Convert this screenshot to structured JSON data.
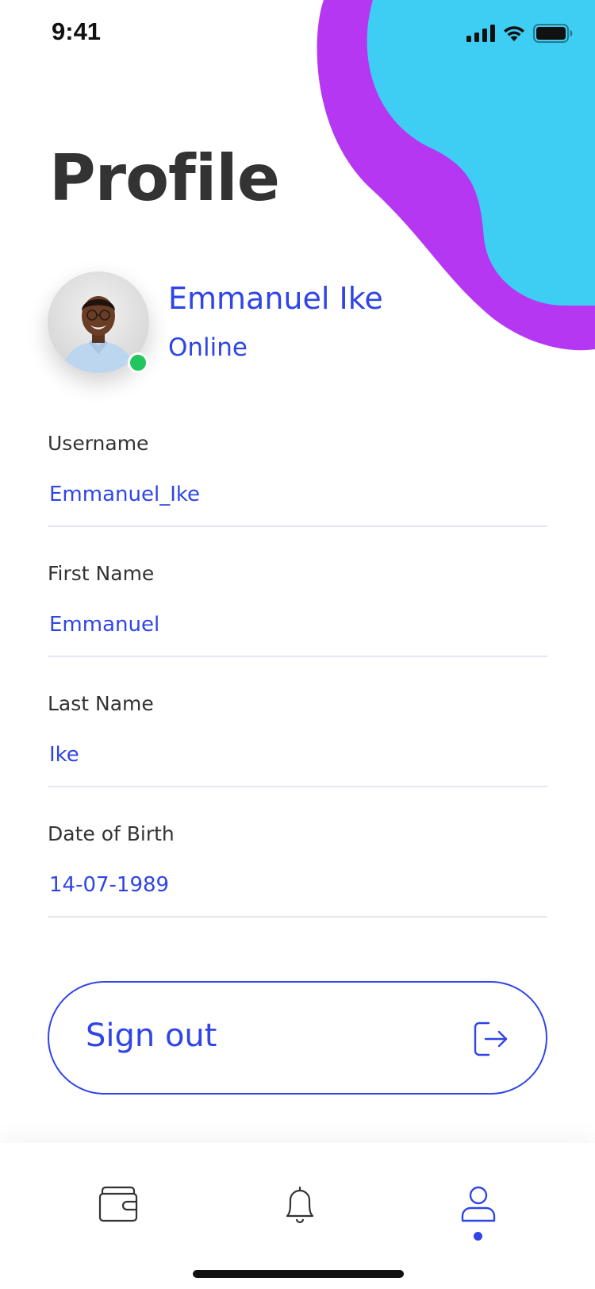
{
  "status_bar": {
    "time": "9:41"
  },
  "colors": {
    "accent": "#2f45e6",
    "blob_purple": "#b537f2",
    "blob_cyan": "#3ecef4",
    "online": "#22c55e",
    "title": "#333333"
  },
  "page": {
    "title": "Profile"
  },
  "profile": {
    "name": "Emmanuel Ike",
    "status": "Online"
  },
  "fields": [
    {
      "label": "Username",
      "value": "Emmanuel_Ike"
    },
    {
      "label": "First Name",
      "value": "Emmanuel"
    },
    {
      "label": "Last Name",
      "value": "Ike"
    },
    {
      "label": "Date of Birth",
      "value": "14-07-1989"
    }
  ],
  "signout": {
    "label": "Sign out",
    "icon": "logout-icon"
  },
  "bottom_nav": {
    "items": [
      {
        "icon": "wallet-icon",
        "active": false
      },
      {
        "icon": "bell-icon",
        "active": false
      },
      {
        "icon": "user-icon",
        "active": true
      }
    ]
  }
}
